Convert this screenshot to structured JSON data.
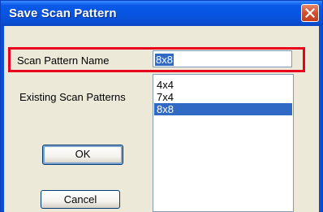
{
  "dialog": {
    "title": "Save Scan Pattern",
    "close_icon": "close-x-icon"
  },
  "form": {
    "name_label": "Scan Pattern Name",
    "name_value": "8x8",
    "existing_label": "Existing Scan Patterns"
  },
  "patterns": {
    "items": [
      "4x4",
      "7x4",
      "8x8"
    ],
    "selected": "8x8"
  },
  "buttons": {
    "ok": "OK",
    "cancel": "Cancel"
  },
  "colors": {
    "title_bar": "#0654e0",
    "highlight_annotation": "#e8001c",
    "selection": "#316ac5",
    "close_button": "#d2502e"
  }
}
